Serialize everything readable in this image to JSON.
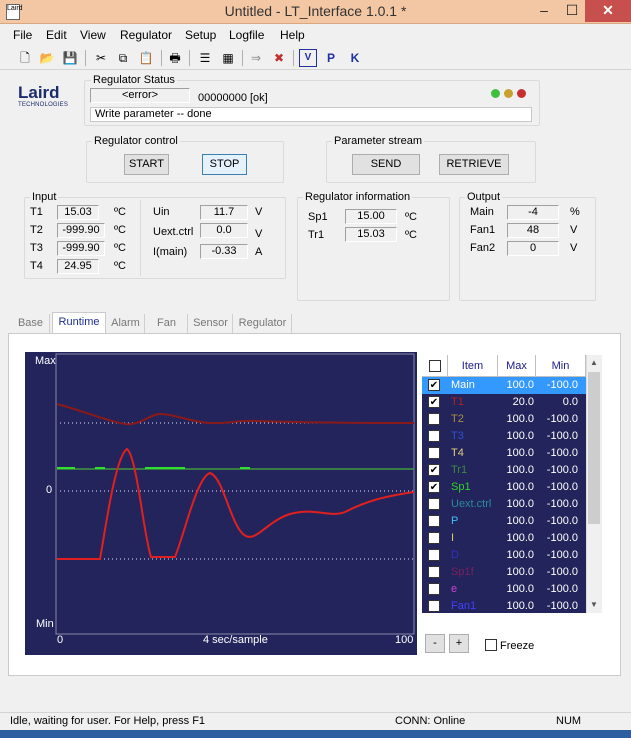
{
  "window": {
    "title": "Untitled - LT_Interface 1.0.1 *",
    "app_icon_text": "Laird",
    "min_glyph": "–",
    "max_glyph": "☐",
    "close_glyph": "✕"
  },
  "menu": [
    "File",
    "Edit",
    "View",
    "Regulator",
    "Setup",
    "Logfile",
    "Help"
  ],
  "toolbar": {
    "icons": [
      "new-icon",
      "open-icon",
      "save-icon",
      "cut-icon",
      "copy-icon",
      "paste-icon",
      "print-icon",
      "list-icon",
      "graph-icon",
      "connect-icon",
      "disconnect-icon",
      "v-icon",
      "p-icon",
      "k-icon"
    ],
    "glyphs": [
      "🗋",
      "📂",
      "💾",
      "✂",
      "⧉",
      "📋",
      "🖶",
      "☰",
      "▦",
      "⇒",
      "✖",
      "V",
      "P",
      "K"
    ]
  },
  "logo": {
    "text": "Laird",
    "sub": "TECHNOLOGIES"
  },
  "regulator_status": {
    "title": "Regulator Status",
    "error_field": "<error>",
    "code": "00000000 [ok]",
    "message": "Write parameter -- done",
    "led_colors": [
      "#3fbf3f",
      "#c8a030",
      "#c83030"
    ]
  },
  "regulator_control": {
    "title": "Regulator control",
    "start": "START",
    "stop": "STOP"
  },
  "parameter_stream": {
    "title": "Parameter stream",
    "send": "SEND",
    "retrieve": "RETRIEVE"
  },
  "input": {
    "title": "Input",
    "rows": [
      {
        "label": "T1",
        "value": "15.03",
        "unit": "ºC"
      },
      {
        "label": "T2",
        "value": "-999.90",
        "unit": "ºC"
      },
      {
        "label": "T3",
        "value": "-999.90",
        "unit": "ºC"
      },
      {
        "label": "T4",
        "value": "24.95",
        "unit": "ºC"
      }
    ],
    "rows2": [
      {
        "label": "Uin",
        "value": "11.7",
        "unit": "V"
      },
      {
        "label": "Uext.ctrl",
        "value": "0.0",
        "unit": "V"
      },
      {
        "label": "I(main)",
        "value": "-0.33",
        "unit": "A"
      }
    ]
  },
  "regulator_info": {
    "title": "Regulator information",
    "rows": [
      {
        "label": "Sp1",
        "value": "15.00",
        "unit": "ºC"
      },
      {
        "label": "Tr1",
        "value": "15.03",
        "unit": "ºC"
      }
    ]
  },
  "output": {
    "title": "Output",
    "rows": [
      {
        "label": "Main",
        "value": "-4",
        "unit": "%"
      },
      {
        "label": "Fan1",
        "value": "48",
        "unit": "V"
      },
      {
        "label": "Fan2",
        "value": "0",
        "unit": "V"
      }
    ]
  },
  "tabs": [
    "Base",
    "Runtime",
    "Alarm",
    "Fan",
    "Sensor",
    "Regulator"
  ],
  "active_tab": "Runtime",
  "chart": {
    "y_max_label": "Max",
    "y_zero_label": "0",
    "y_min_label": "Min",
    "x_start": "0",
    "x_end": "100",
    "x_label": "4 sec/sample"
  },
  "list": {
    "headers": [
      "Item",
      "Max",
      "Min"
    ],
    "rows": [
      {
        "name": "Main",
        "max": "100.0",
        "min": "-100.0",
        "checked": true,
        "color": "#ffffff",
        "selected": true
      },
      {
        "name": "T1",
        "max": "20.0",
        "min": "0.0",
        "checked": true,
        "color": "#b52020"
      },
      {
        "name": "T2",
        "max": "100.0",
        "min": "-100.0",
        "checked": false,
        "color": "#a89040"
      },
      {
        "name": "T3",
        "max": "100.0",
        "min": "-100.0",
        "checked": false,
        "color": "#3050d0"
      },
      {
        "name": "T4",
        "max": "100.0",
        "min": "-100.0",
        "checked": false,
        "color": "#e0d080"
      },
      {
        "name": "Tr1",
        "max": "100.0",
        "min": "-100.0",
        "checked": true,
        "color": "#3c8a3c"
      },
      {
        "name": "Sp1",
        "max": "100.0",
        "min": "-100.0",
        "checked": true,
        "color": "#30d030"
      },
      {
        "name": "Uext.ctrl",
        "max": "100.0",
        "min": "-100.0",
        "checked": false,
        "color": "#2a8a9a"
      },
      {
        "name": "P",
        "max": "100.0",
        "min": "-100.0",
        "checked": false,
        "color": "#40c0ff"
      },
      {
        "name": "I",
        "max": "100.0",
        "min": "-100.0",
        "checked": false,
        "color": "#e0d060"
      },
      {
        "name": "D",
        "max": "100.0",
        "min": "-100.0",
        "checked": false,
        "color": "#3030c0"
      },
      {
        "name": "Sp1f",
        "max": "100.0",
        "min": "-100.0",
        "checked": false,
        "color": "#7a2060"
      },
      {
        "name": "e",
        "max": "100.0",
        "min": "-100.0",
        "checked": false,
        "color": "#d040d0"
      },
      {
        "name": "Fan1",
        "max": "100.0",
        "min": "-100.0",
        "checked": false,
        "color": "#4040ff"
      }
    ]
  },
  "controls": {
    "minus": "-",
    "plus": "+",
    "freeze": "Freeze"
  },
  "status": {
    "message": "Idle, waiting for user. For Help, press F1",
    "conn": "CONN: Online",
    "num": "NUM"
  }
}
